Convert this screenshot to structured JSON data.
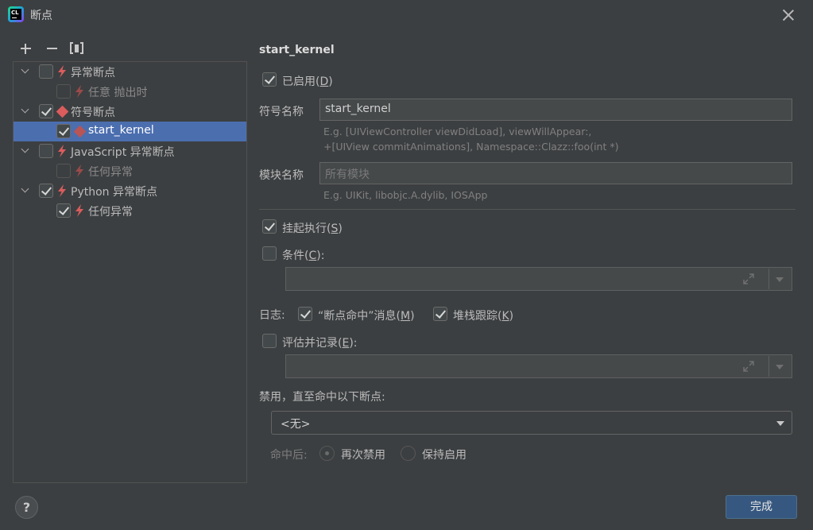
{
  "window": {
    "title": "断点"
  },
  "toolbar": {
    "add": "add-breakpoint",
    "remove": "remove-breakpoint",
    "group": "group-by"
  },
  "tree": {
    "items": [
      {
        "label": "异常断点",
        "checked": false,
        "expanded": true,
        "icon": "lightning-icon",
        "level": 0
      },
      {
        "label": "任意 抛出时",
        "checked": false,
        "icon": "lightning-icon",
        "level": 1,
        "dim": true
      },
      {
        "label": "符号断点",
        "checked": true,
        "expanded": true,
        "icon": "diamond-icon",
        "level": 0
      },
      {
        "label": "start_kernel",
        "checked": true,
        "icon": "diamond-icon",
        "level": 1,
        "selected": true
      },
      {
        "label": "JavaScript 异常断点",
        "checked": false,
        "expanded": true,
        "icon": "lightning-icon",
        "level": 0
      },
      {
        "label": "任何异常",
        "checked": false,
        "icon": "lightning-icon",
        "level": 1,
        "dim": true
      },
      {
        "label": "Python 异常断点",
        "checked": true,
        "expanded": true,
        "icon": "lightning-icon",
        "level": 0
      },
      {
        "label": "任何异常",
        "checked": true,
        "icon": "lightning-icon",
        "level": 1
      }
    ]
  },
  "details": {
    "heading": "start_kernel",
    "enabled": {
      "label": "已启用(",
      "mnemonic": "D",
      "suffix": ")",
      "checked": true
    },
    "symbol": {
      "label": "符号名称",
      "value": "start_kernel",
      "hint1": "E.g. [UIViewController viewDidLoad], viewWillAppear:,",
      "hint2": "+[UIView commitAnimations], Namespace::Clazz::foo(int *)"
    },
    "module": {
      "label": "模块名称",
      "placeholder": "所有模块",
      "hint": "E.g. UIKit, libobjc.A.dylib, IOSApp"
    },
    "suspend": {
      "label": "挂起执行(",
      "mnemonic": "S",
      "suffix": ")",
      "checked": true
    },
    "condition": {
      "label": "条件(",
      "mnemonic": "C",
      "suffix": "):",
      "checked": false,
      "value": ""
    },
    "log": {
      "label": "日志:",
      "message": {
        "label": "“断点命中”消息(",
        "mnemonic": "M",
        "suffix": ")",
        "checked": true
      },
      "stack": {
        "label": "堆栈跟踪(",
        "mnemonic": "K",
        "suffix": ")",
        "checked": true
      }
    },
    "evaluate": {
      "label": "评估并记录(",
      "mnemonic": "E",
      "suffix": "):",
      "checked": false,
      "value": ""
    },
    "disable_until": {
      "label": "禁用，直至命中以下断点:",
      "selected": "<无>"
    },
    "after_hit": {
      "label": "命中后:",
      "options": [
        "再次禁用",
        "保持启用"
      ],
      "selected": "再次禁用"
    }
  },
  "footer": {
    "help": "?",
    "done": "完成"
  },
  "colors": {
    "background": "#3c3f41",
    "selection": "#4b6eaf",
    "accent_button": "#365880",
    "breakpoint_red": "#db5c5c"
  }
}
